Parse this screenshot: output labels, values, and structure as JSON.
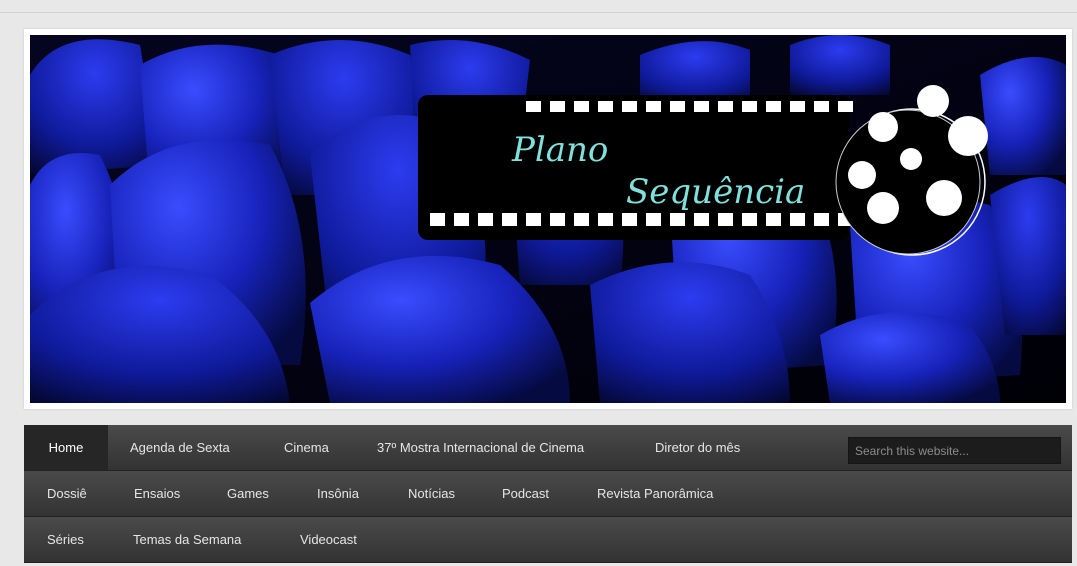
{
  "site": {
    "logo_line1": "Plano",
    "logo_line2": "Sequência"
  },
  "nav": {
    "rows": [
      [
        "Home",
        "Agenda de Sexta",
        "Cinema",
        "37º Mostra Internacional de Cinema",
        "Diretor do mês"
      ],
      [
        "Dossiê",
        "Ensaios",
        "Games",
        "Insônia",
        "Notícias",
        "Podcast",
        "Revista Panorâmica"
      ],
      [
        "Séries",
        "Temas da Semana",
        "Videocast"
      ]
    ],
    "active": "Home"
  },
  "search": {
    "placeholder": "Search this website..."
  },
  "colors": {
    "page_bg": "#e8e8e8",
    "nav_bg": "#3c3c3c",
    "seat_blue": "#1a2bd6",
    "logo_text": "#7fe0dc"
  },
  "icons": {
    "logo": "film-reel-icon"
  }
}
